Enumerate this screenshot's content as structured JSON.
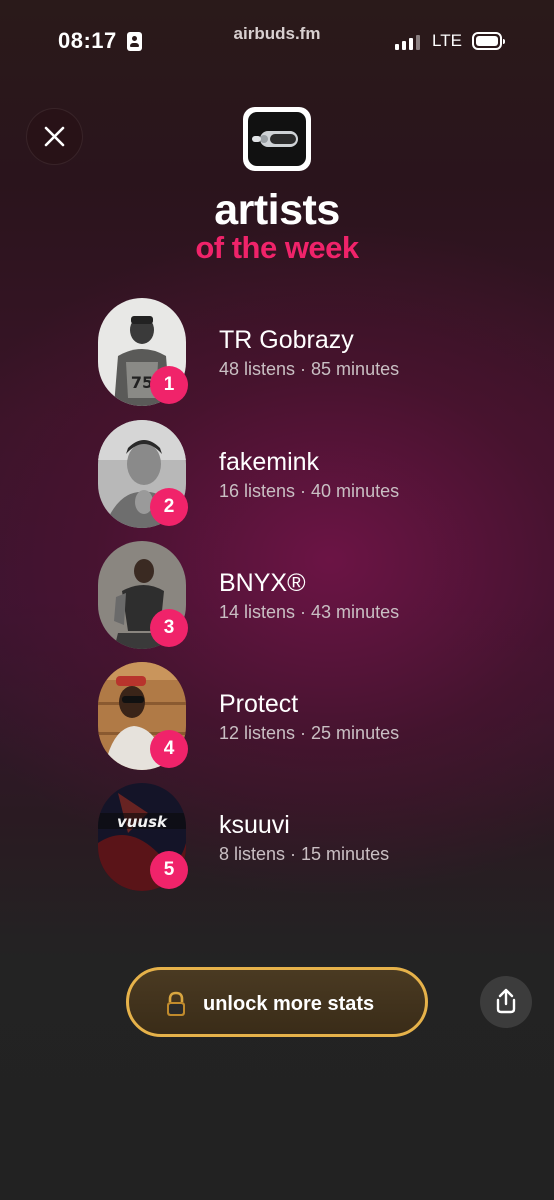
{
  "status_bar": {
    "time": "08:17",
    "site": "airbuds.fm",
    "network": "LTE"
  },
  "header": {
    "title": "artists",
    "subtitle": "of the week"
  },
  "artists": [
    {
      "rank": "1",
      "name": "TR Gobrazy",
      "stats": "48 listens · 85 minutes"
    },
    {
      "rank": "2",
      "name": "fakemink",
      "stats": "16 listens · 40 minutes"
    },
    {
      "rank": "3",
      "name": "BNYX®",
      "stats": "14 listens · 43 minutes"
    },
    {
      "rank": "4",
      "name": "Protect",
      "stats": "12 listens · 25 minutes"
    },
    {
      "rank": "5",
      "name": "ksuuvi",
      "stats": "8 listens · 15 minutes"
    }
  ],
  "actions": {
    "unlock_label": "unlock more stats"
  },
  "icons": {
    "close": "close-icon",
    "share": "share-icon",
    "lock": "lock-icon",
    "logo": "airbuds-logo-icon",
    "battery": "battery-icon",
    "signal": "signal-icon"
  },
  "colors": {
    "accent": "#f0236a",
    "gold": "#e6b24a"
  }
}
